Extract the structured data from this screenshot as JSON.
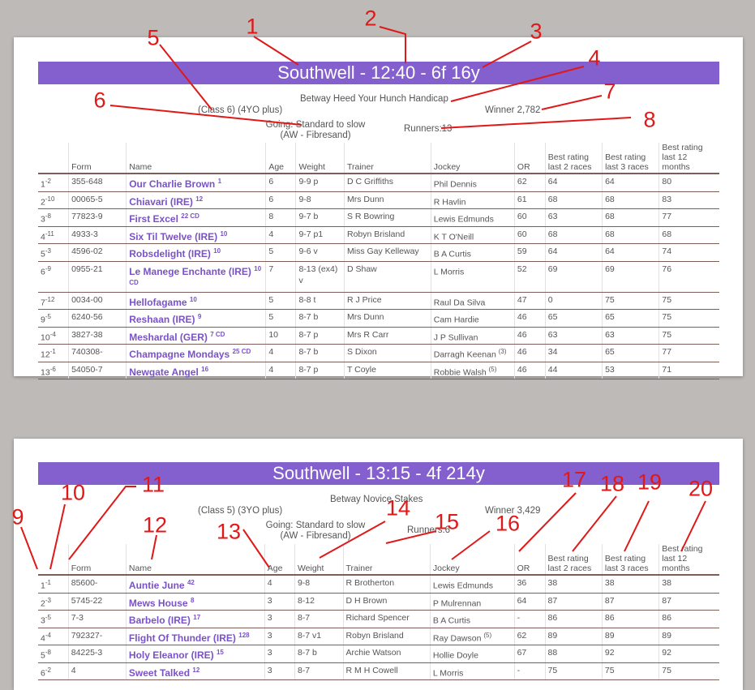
{
  "races": [
    {
      "title": "Southwell - 12:40 - 6f 16y",
      "race_name": "Betway Heed Your Hunch Handicap",
      "class_age": "(Class 6) (4YO plus)",
      "winner": "Winner 2,782",
      "going": "Going: Standard to slow (AW - Fibresand)",
      "runners_label": "Runners:13",
      "headers": [
        "",
        "Form",
        "Name",
        "Age",
        "Weight",
        "Trainer",
        "Jockey",
        "OR",
        "Best rating last 2 races",
        "Best rating last 3 races",
        "Best rating last 12 months"
      ],
      "rows": [
        {
          "pos": "1",
          "sup": "-2",
          "form": "355-648",
          "name": "Our Charlie Brown",
          "name_sup": "1",
          "age": "6",
          "weight": "9-9 p",
          "trainer": "D C Griffiths",
          "jockey": "Phil Dennis",
          "jsup": "",
          "or": "62",
          "b2": "64",
          "b3": "64",
          "b12": "80"
        },
        {
          "pos": "2",
          "sup": "-10",
          "form": "00065-5",
          "name": "Chiavari (IRE)",
          "name_sup": "12",
          "age": "6",
          "weight": "9-8",
          "trainer": "Mrs Dunn",
          "jockey": "R Havlin",
          "jsup": "",
          "or": "61",
          "b2": "68",
          "b3": "68",
          "b12": "83"
        },
        {
          "pos": "3",
          "sup": "-8",
          "form": "77823-9",
          "name": "First Excel",
          "name_sup": "22 CD",
          "age": "8",
          "weight": "9-7 b",
          "trainer": "S R Bowring",
          "jockey": "Lewis Edmunds",
          "jsup": "",
          "or": "60",
          "b2": "63",
          "b3": "68",
          "b12": "77"
        },
        {
          "pos": "4",
          "sup": "-11",
          "form": "4933-3",
          "name": "Six Til Twelve (IRE)",
          "name_sup": "10",
          "age": "4",
          "weight": "9-7 p1",
          "trainer": "Robyn Brisland",
          "jockey": "K T O'Neill",
          "jsup": "",
          "or": "60",
          "b2": "68",
          "b3": "68",
          "b12": "68"
        },
        {
          "pos": "5",
          "sup": "-3",
          "form": "4596-02",
          "name": "Robsdelight (IRE)",
          "name_sup": "10",
          "age": "5",
          "weight": "9-6 v",
          "trainer": "Miss Gay Kelleway",
          "jockey": "B A Curtis",
          "jsup": "",
          "or": "59",
          "b2": "64",
          "b3": "64",
          "b12": "74"
        },
        {
          "pos": "6",
          "sup": "-9",
          "form": "0955-21",
          "name": "Le Manege Enchante (IRE)",
          "name_sup": "10 CD",
          "age": "7",
          "weight": "8-13 (ex4) v",
          "trainer": "D Shaw",
          "jockey": "L Morris",
          "jsup": "",
          "or": "52",
          "b2": "69",
          "b3": "69",
          "b12": "76"
        },
        {
          "pos": "7",
          "sup": "-12",
          "form": "0034-00",
          "name": "Hellofagame",
          "name_sup": "10",
          "age": "5",
          "weight": "8-8 t",
          "trainer": "R J Price",
          "jockey": "Raul Da Silva",
          "jsup": "",
          "or": "47",
          "b2": "0",
          "b3": "75",
          "b12": "75"
        },
        {
          "pos": "9",
          "sup": "-5",
          "form": "6240-56",
          "name": "Reshaan (IRE)",
          "name_sup": "9",
          "age": "5",
          "weight": "8-7 b",
          "trainer": "Mrs Dunn",
          "jockey": "Cam Hardie",
          "jsup": "",
          "or": "46",
          "b2": "65",
          "b3": "65",
          "b12": "75"
        },
        {
          "pos": "10",
          "sup": "-4",
          "form": "3827-38",
          "name": "Meshardal (GER)",
          "name_sup": "7 CD",
          "age": "10",
          "weight": "8-7 p",
          "trainer": "Mrs R Carr",
          "jockey": "J P Sullivan",
          "jsup": "",
          "or": "46",
          "b2": "63",
          "b3": "63",
          "b12": "75"
        },
        {
          "pos": "12",
          "sup": "-1",
          "form": "740308-",
          "name": "Champagne Mondays",
          "name_sup": "25 CD",
          "age": "4",
          "weight": "8-7 b",
          "trainer": "S Dixon",
          "jockey": "Darragh Keenan",
          "jsup": "(3)",
          "or": "46",
          "b2": "34",
          "b3": "65",
          "b12": "77"
        },
        {
          "pos": "13",
          "sup": "-6",
          "form": "54050-7",
          "name": "Newgate Angel",
          "name_sup": "16",
          "age": "4",
          "weight": "8-7 p",
          "trainer": "T Coyle",
          "jockey": "Robbie Walsh",
          "jsup": "(5)",
          "or": "46",
          "b2": "44",
          "b3": "53",
          "b12": "71"
        }
      ]
    },
    {
      "title": "Southwell - 13:15 - 4f 214y",
      "race_name": "Betway Novice Stakes",
      "class_age": "(Class 5) (3YO plus)",
      "winner": "Winner 3,429",
      "going": "Going: Standard to slow (AW - Fibresand)",
      "runners_label": "Runners:6",
      "headers": [
        "",
        "Form",
        "Name",
        "Age",
        "Weight",
        "Trainer",
        "Jockey",
        "OR",
        "Best rating last 2 races",
        "Best rating last 3 races",
        "Best rating last 12 months"
      ],
      "rows": [
        {
          "pos": "1",
          "sup": "-1",
          "form": "85600-",
          "name": "Auntie June",
          "name_sup": "42",
          "age": "4",
          "weight": "9-8",
          "trainer": "R Brotherton",
          "jockey": "Lewis Edmunds",
          "jsup": "",
          "or": "36",
          "b2": "38",
          "b3": "38",
          "b12": "38"
        },
        {
          "pos": "2",
          "sup": "-3",
          "form": "5745-22",
          "name": "Mews House",
          "name_sup": "8",
          "age": "3",
          "weight": "8-12",
          "trainer": "D H Brown",
          "jockey": "P Mulrennan",
          "jsup": "",
          "or": "64",
          "b2": "87",
          "b3": "87",
          "b12": "87"
        },
        {
          "pos": "3",
          "sup": "-5",
          "form": "7-3",
          "name": "Barbelo (IRE)",
          "name_sup": "17",
          "age": "3",
          "weight": "8-7",
          "trainer": "Richard Spencer",
          "jockey": "B A Curtis",
          "jsup": "",
          "or": "-",
          "b2": "86",
          "b3": "86",
          "b12": "86"
        },
        {
          "pos": "4",
          "sup": "-4",
          "form": "792327-",
          "name": "Flight Of Thunder (IRE)",
          "name_sup": "128",
          "age": "3",
          "weight": "8-7 v1",
          "trainer": "Robyn Brisland",
          "jockey": "Ray Dawson",
          "jsup": "(5)",
          "or": "62",
          "b2": "89",
          "b3": "89",
          "b12": "89"
        },
        {
          "pos": "5",
          "sup": "-8",
          "form": "84225-3",
          "name": "Holy Eleanor (IRE)",
          "name_sup": "15",
          "age": "3",
          "weight": "8-7 b",
          "trainer": "Archie Watson",
          "jockey": "Hollie Doyle",
          "jsup": "",
          "or": "67",
          "b2": "88",
          "b3": "92",
          "b12": "92"
        },
        {
          "pos": "6",
          "sup": "-2",
          "form": "4",
          "name": "Sweet Talked",
          "name_sup": "12",
          "age": "3",
          "weight": "8-7",
          "trainer": "R M H Cowell",
          "jockey": "L Morris",
          "jsup": "",
          "or": "-",
          "b2": "75",
          "b3": "75",
          "b12": "75"
        }
      ]
    }
  ],
  "annotations": [
    "1",
    "2",
    "3",
    "4",
    "5",
    "6",
    "7",
    "8",
    "9",
    "10",
    "11",
    "12",
    "13",
    "14",
    "15",
    "16",
    "17",
    "18",
    "19",
    "20"
  ],
  "colors": {
    "title_bar": "#8460cf",
    "horse_name": "#7a52c7",
    "annotation": "#e01818",
    "row_border": "#7b5e57",
    "background": "#bdbab7"
  }
}
